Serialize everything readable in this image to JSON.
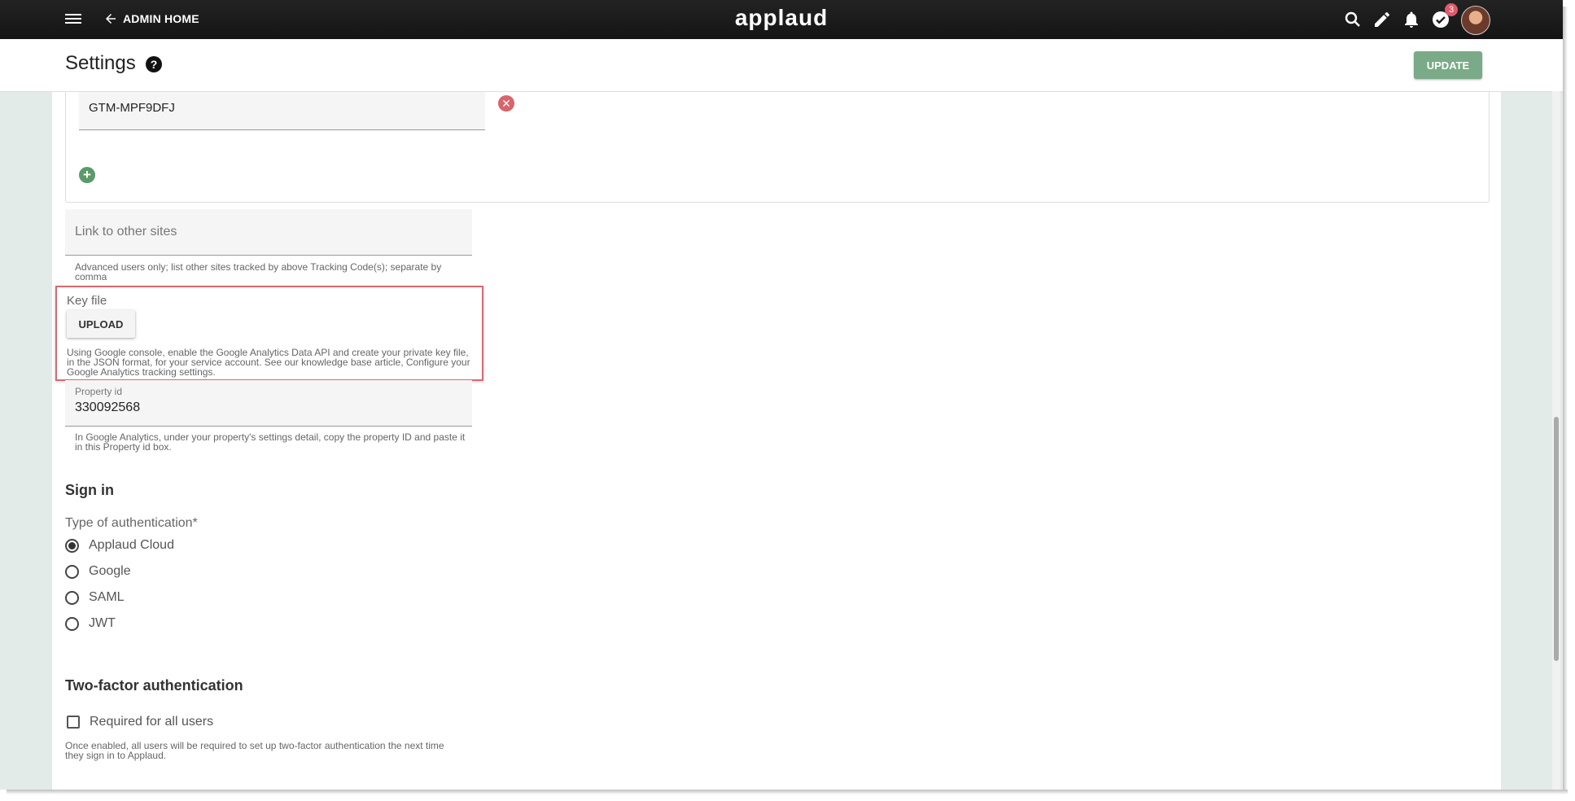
{
  "topbar": {
    "back_label": "ADMIN HOME",
    "logo": "applaud",
    "notification_count": "3"
  },
  "header": {
    "title": "Settings",
    "help_symbol": "?",
    "update_label": "UPDATE"
  },
  "tracking": {
    "code_value": "GTM-MPF9DFJ",
    "remove_symbol": "✕",
    "add_symbol": "+"
  },
  "link_sites": {
    "placeholder": "Link to other sites",
    "hint": "Advanced users only; list other sites tracked by above Tracking Code(s); separate by comma"
  },
  "key_file": {
    "label": "Key file",
    "upload_label": "UPLOAD",
    "hint": "Using Google console, enable the Google Analytics Data API and create your private key file, in the JSON format, for your service account. See our knowledge base article, Configure your Google Analytics tracking settings."
  },
  "property": {
    "label": "Property id",
    "value": "330092568",
    "hint": "In Google Analytics, under your property's settings detail, copy the property ID and paste it in this Property id box."
  },
  "sign_in": {
    "title": "Sign in",
    "auth_label": "Type of authentication*",
    "options": [
      {
        "label": "Applaud Cloud",
        "selected": true
      },
      {
        "label": "Google",
        "selected": false
      },
      {
        "label": "SAML",
        "selected": false
      },
      {
        "label": "JWT",
        "selected": false
      }
    ]
  },
  "two_factor": {
    "title": "Two-factor authentication",
    "checkbox_label": "Required for all users",
    "hint": "Once enabled, all users will be required to set up two-factor authentication the next time they sign in to Applaud."
  },
  "colors": {
    "accent_green": "#7aaa87",
    "remove_red": "#d9646b",
    "highlight_border": "#d46b74"
  }
}
